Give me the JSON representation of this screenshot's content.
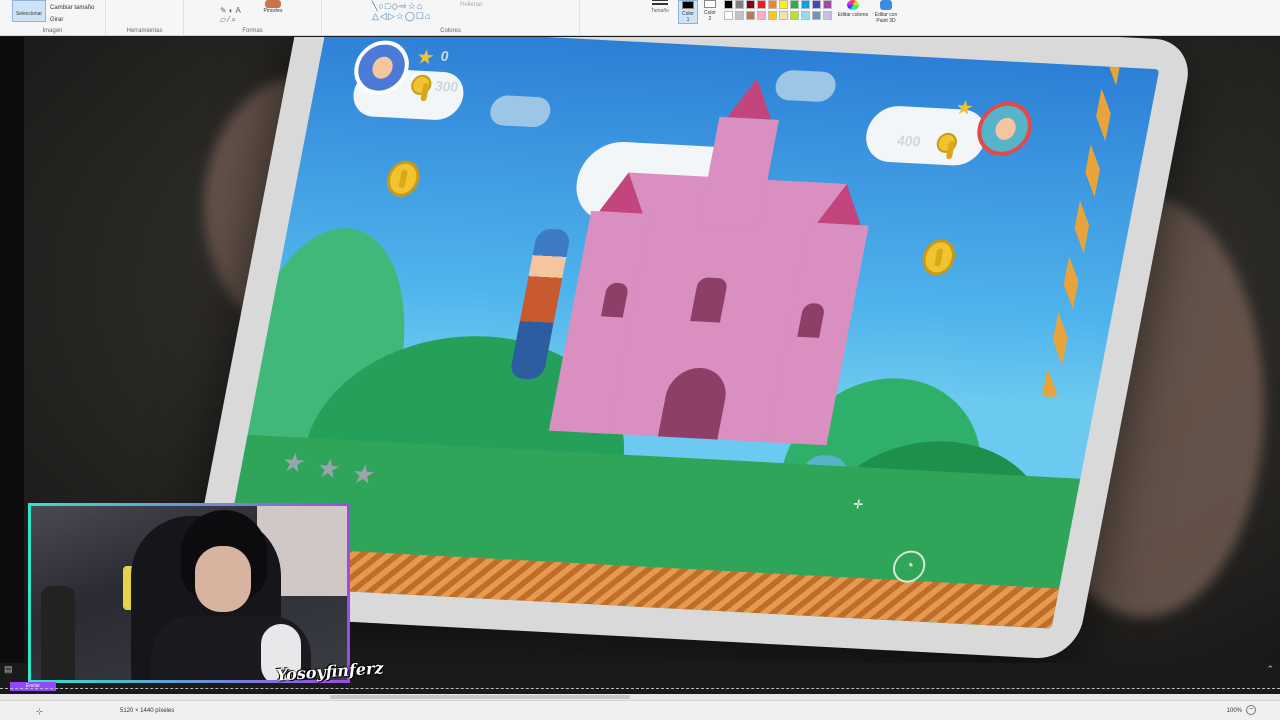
{
  "ribbon": {
    "select_label": "Seleccionar",
    "image_items": [
      "Cambiar tamaño",
      "Girar"
    ],
    "image_group": "Imagen",
    "tools_group": "Herramientas",
    "brushes_label": "Pinceles",
    "shapes_group": "Formas",
    "outline_label": "Rellenar",
    "size_label": "Tamaño",
    "color1_label": "Color\n1",
    "color2_label": "Color\n2",
    "colors_group": "Colores",
    "edit_colors_label": "Editar colores",
    "paint3d_label": "Editar con Paint 3D",
    "palette": [
      "#000000",
      "#7f7f7f",
      "#880015",
      "#ed1c24",
      "#ff7f27",
      "#fff200",
      "#22b14c",
      "#00a2e8",
      "#3f48cc",
      "#a349a4",
      "#ffffff",
      "#c3c3c3",
      "#b97a57",
      "#ffaec9",
      "#ffc90e",
      "#efe4b0",
      "#b5e61d",
      "#99d9ea",
      "#7092be",
      "#c8bfe7"
    ]
  },
  "game": {
    "player1_stars": "0",
    "player1_coins": "300",
    "player2_coins": "400"
  },
  "overlay": {
    "signature": "Yosoyfinferz",
    "chat_badge": "Enviar"
  },
  "status": {
    "dimensions": "5120 × 1440 píxeles",
    "zoom": "100%"
  }
}
